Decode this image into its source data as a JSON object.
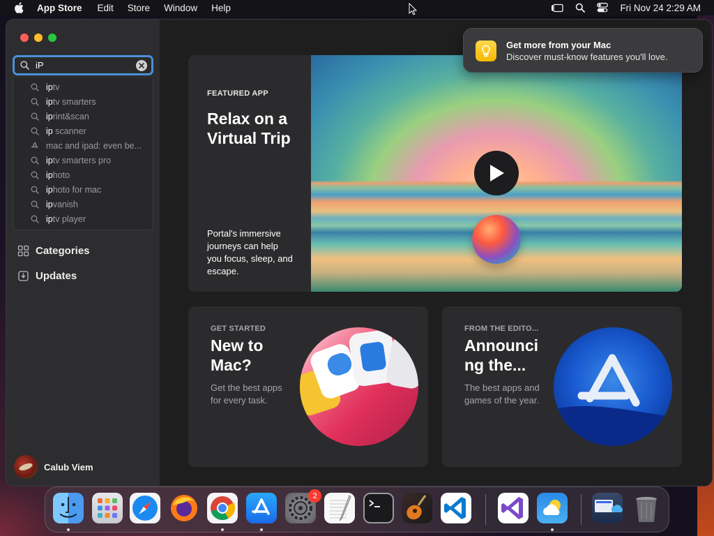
{
  "menubar": {
    "app_name": "App Store",
    "items": [
      "Edit",
      "Store",
      "Window",
      "Help"
    ],
    "clock": "Fri Nov 24  2:29 AM"
  },
  "search": {
    "value": "iP",
    "suggestions": [
      {
        "bold": "ip",
        "rest": "tv",
        "icon": "search-icon"
      },
      {
        "bold": "ip",
        "rest": "tv smarters",
        "icon": "search-icon"
      },
      {
        "bold": "ip",
        "rest": "rint&scan",
        "icon": "search-icon"
      },
      {
        "bold": "ip",
        "rest": " scanner",
        "icon": "search-icon"
      },
      {
        "bold": "",
        "rest": "mac and ipad: even be...",
        "icon": "app-store-icon"
      },
      {
        "bold": "ip",
        "rest": "tv smarters pro",
        "icon": "search-icon"
      },
      {
        "bold": "ip",
        "rest": "hoto",
        "icon": "search-icon"
      },
      {
        "bold": "ip",
        "rest": "hoto for mac",
        "icon": "search-icon"
      },
      {
        "bold": "ip",
        "rest": "vanish",
        "icon": "search-icon"
      },
      {
        "bold": "ip",
        "rest": "tv player",
        "icon": "search-icon"
      }
    ]
  },
  "sidebar": {
    "categories": "Categories",
    "updates": "Updates",
    "user_name": "Calub Viem"
  },
  "featured": {
    "eyebrow": "FEATURED APP",
    "title": "Relax on a Virtual Trip",
    "description": "Portal's immersive journeys can help you focus, sleep, and escape."
  },
  "cards": [
    {
      "eyebrow": "GET STARTED",
      "title": "New to Mac?",
      "description": "Get the best apps for every task."
    },
    {
      "eyebrow": "FROM THE EDITO...",
      "title": "Announci ng the...",
      "description": "The best apps and games of the year."
    }
  ],
  "notification": {
    "title": "Get more from your Mac",
    "body": "Discover must-know features you'll love."
  },
  "dock": {
    "items": [
      "Finder",
      "Launchpad",
      "Safari",
      "Firefox",
      "Chrome",
      "App Store",
      "System Settings",
      "TextEdit",
      "Terminal",
      "GarageBand",
      "Visual Studio Code",
      "Visual Studio",
      "Weather",
      "Screen Sharing",
      "Trash"
    ],
    "settings_badge": "2"
  },
  "colors": {
    "accent": "#4a90d9",
    "window_bg": "#1e1e1f",
    "sidebar_bg": "#2d2d2f",
    "card_bg": "#2b2b2d"
  }
}
